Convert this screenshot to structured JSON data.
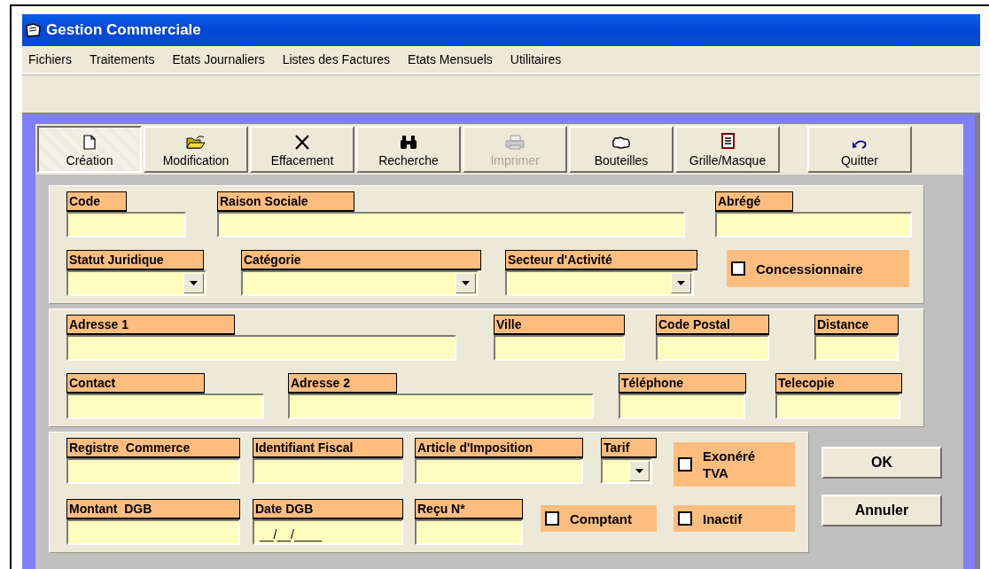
{
  "window": {
    "title": "Gestion Commerciale"
  },
  "menu": [
    "Fichiers",
    "Traitements",
    "Etats Journaliers",
    "Listes des Factures",
    "Etats Mensuels",
    "Utilitaires"
  ],
  "toolbar": [
    {
      "label": "Création",
      "selected": true,
      "disabled": false
    },
    {
      "label": "Modification",
      "selected": false,
      "disabled": false
    },
    {
      "label": "Effacement",
      "selected": false,
      "disabled": false
    },
    {
      "label": "Recherche",
      "selected": false,
      "disabled": false
    },
    {
      "label": "Imprimer",
      "selected": false,
      "disabled": true
    },
    {
      "label": "Bouteilles",
      "selected": false,
      "disabled": false
    },
    {
      "label": "Grille/Masque",
      "selected": false,
      "disabled": false
    },
    {
      "label": "Quitter",
      "selected": false,
      "disabled": false
    }
  ],
  "sections": [
    {
      "rows": [
        [
          {
            "kind": "text",
            "label": "Code"
          },
          {
            "kind": "text",
            "label": "Raison Sociale"
          },
          {
            "kind": "text",
            "label": "Abrégé"
          }
        ],
        [
          {
            "kind": "combo",
            "label": "Statut Juridique"
          },
          {
            "kind": "combo",
            "label": "Catégorie"
          },
          {
            "kind": "combo",
            "label": "Secteur d'Activité"
          },
          {
            "kind": "check",
            "label": "Concessionnaire",
            "checked": false
          }
        ]
      ]
    },
    {
      "rows": [
        [
          {
            "kind": "text",
            "label": "Adresse 1"
          },
          {
            "kind": "text",
            "label": "Ville"
          },
          {
            "kind": "text",
            "label": "Code Postal"
          },
          {
            "kind": "text",
            "label": "Distance"
          }
        ],
        [
          {
            "kind": "text",
            "label": "Contact"
          },
          {
            "kind": "text",
            "label": "Adresse 2"
          },
          {
            "kind": "text",
            "label": "Téléphone"
          },
          {
            "kind": "text",
            "label": "Telecopie"
          }
        ]
      ]
    },
    {
      "rows": [
        [
          {
            "kind": "text",
            "label": "Registre  Commerce"
          },
          {
            "kind": "text",
            "label": "Identifiant Fiscal"
          },
          {
            "kind": "text",
            "label": "Article d'Imposition"
          },
          {
            "kind": "combo",
            "label": "Tarif"
          },
          {
            "kind": "check",
            "label": "Exonéré TVA",
            "checked": false
          }
        ],
        [
          {
            "kind": "text",
            "label": "Montant  DGB"
          },
          {
            "kind": "text",
            "label": "Date DGB",
            "value": "__/__/____"
          },
          {
            "kind": "text",
            "label": "Reçu N*"
          },
          {
            "kind": "check",
            "label": "Comptant",
            "checked": false
          },
          {
            "kind": "check",
            "label": "Inactif",
            "checked": false
          }
        ]
      ]
    }
  ],
  "buttons": [
    "OK",
    "Annuler"
  ]
}
